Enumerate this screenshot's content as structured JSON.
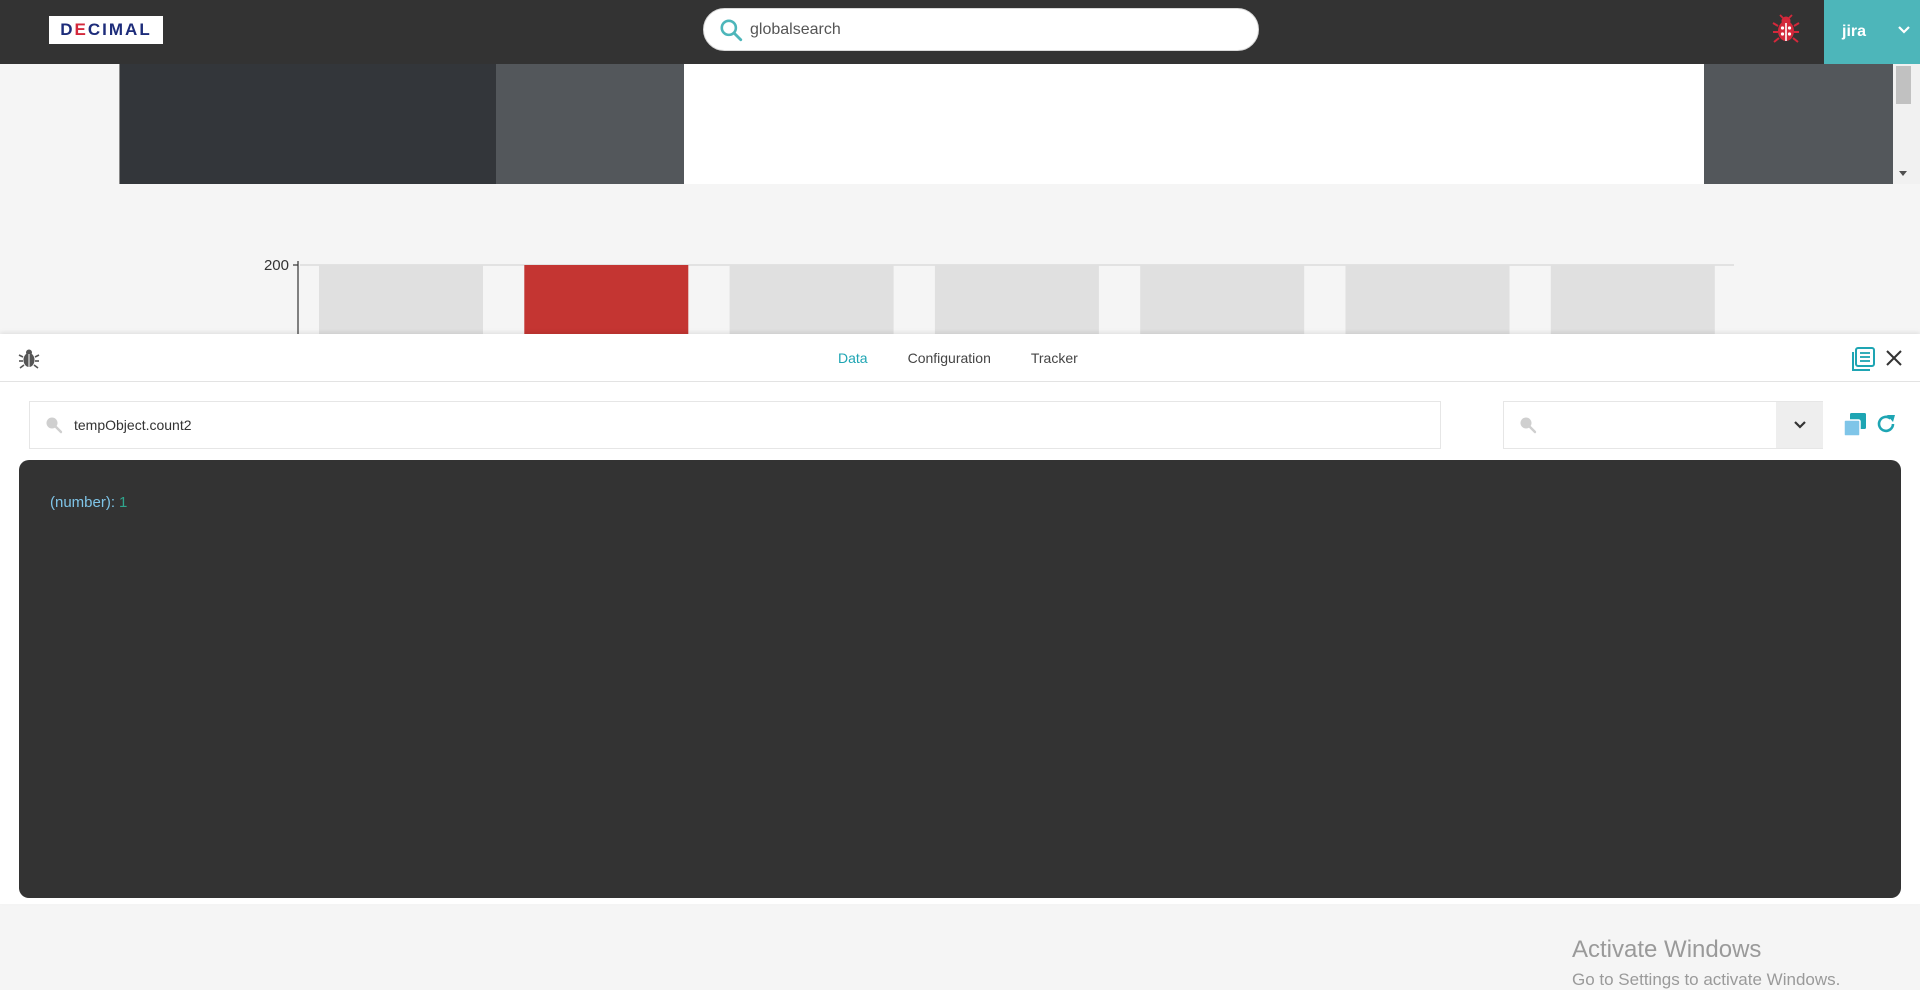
{
  "topbar": {
    "logo_text": "DECIMAL",
    "search": {
      "value": "globalsearch",
      "placeholder": ""
    },
    "user": {
      "name": "jira"
    },
    "colors": {
      "bar": "#333333",
      "user_bg": "#4db6ba",
      "bug": "#d4283b"
    }
  },
  "background_chart": {
    "chart_data": {
      "type": "bar",
      "tick_labels": [
        "200"
      ],
      "bars": [
        {
          "highlighted": false
        },
        {
          "highlighted": true
        },
        {
          "highlighted": false
        },
        {
          "highlighted": false
        },
        {
          "highlighted": false
        },
        {
          "highlighted": false
        },
        {
          "highlighted": false
        }
      ],
      "colors": {
        "default": "#e0e0e0",
        "highlight": "#c43532"
      }
    }
  },
  "drawer": {
    "tabs": [
      {
        "label": "Data",
        "active": true
      },
      {
        "label": "Configuration",
        "active": false
      },
      {
        "label": "Tracker",
        "active": false
      }
    ],
    "path_input": {
      "value": "tempObject.count2"
    },
    "filter_input": {
      "value": ""
    },
    "console": {
      "type_label": "(number):",
      "value": "1"
    },
    "accent_color": "#1ea5b3"
  },
  "watermark": {
    "title": "Activate Windows",
    "subtitle": "Go to Settings to activate Windows."
  }
}
